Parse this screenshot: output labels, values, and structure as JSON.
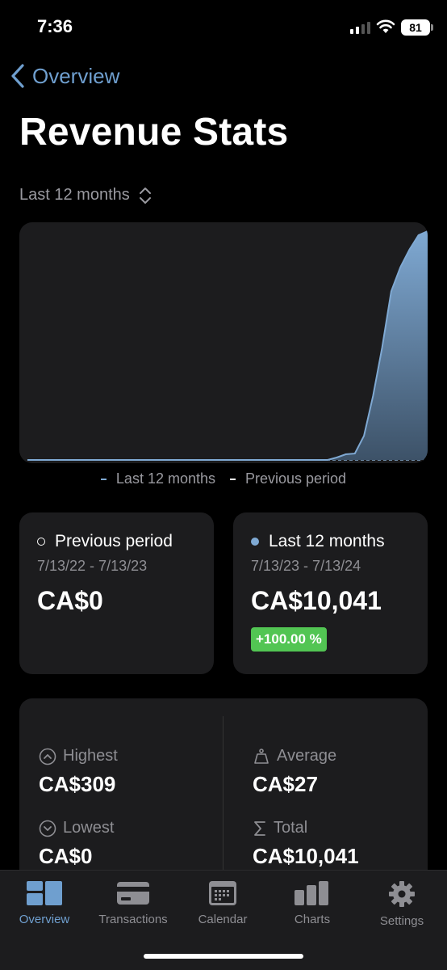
{
  "status_bar": {
    "time": "7:36",
    "battery": "81"
  },
  "nav": {
    "back_label": "Overview",
    "title": "Revenue Stats"
  },
  "range_picker": {
    "label": "Last 12 months"
  },
  "chart_data": {
    "type": "area",
    "series": [
      {
        "name": "Last 12 months",
        "color": "#7fa9d3",
        "values": [
          0,
          0,
          0,
          0,
          0,
          0,
          0,
          0,
          0,
          0,
          0,
          0,
          0,
          0,
          0,
          0,
          0,
          0,
          0,
          0,
          0,
          0,
          0,
          0,
          0,
          0,
          0,
          0,
          0,
          0,
          0,
          0,
          0,
          0,
          3,
          7,
          8,
          30,
          80,
          140,
          210,
          240,
          262,
          280,
          285
        ]
      },
      {
        "name": "Previous period",
        "color": "#ffffff",
        "values": []
      }
    ],
    "ylim": [
      0,
      290
    ],
    "grid": false,
    "legend_placement": "bottom-center"
  },
  "legend": {
    "current": "Last 12 months",
    "previous": "Previous period"
  },
  "periods": {
    "previous": {
      "label": "Previous period",
      "dates": "7/13/22 - 7/13/23",
      "amount": "CA$0"
    },
    "current": {
      "label": "Last 12 months",
      "dates": "7/13/23 - 7/13/24",
      "amount": "CA$10,041",
      "change": "+100.00 %"
    }
  },
  "stats": {
    "highest": {
      "label": "Highest",
      "value": "CA$309",
      "icon": "chevron-up-circle-icon"
    },
    "lowest": {
      "label": "Lowest",
      "value": "CA$0",
      "icon": "chevron-down-circle-icon"
    },
    "average": {
      "label": "Average",
      "value": "CA$27",
      "icon": "scale-icon"
    },
    "total": {
      "label": "Total",
      "value": "CA$10,041",
      "icon": "sigma-icon"
    }
  },
  "tabs": [
    {
      "label": "Overview",
      "icon": "dashboard-icon",
      "active": true
    },
    {
      "label": "Transactions",
      "icon": "credit-card-icon",
      "active": false
    },
    {
      "label": "Calendar",
      "icon": "calendar-icon",
      "active": false
    },
    {
      "label": "Charts",
      "icon": "bar-chart-icon",
      "active": false
    },
    {
      "label": "Settings",
      "icon": "gear-icon",
      "active": false
    }
  ],
  "colors": {
    "accent": "#6f9fcf",
    "positive": "#52c553",
    "card": "#1c1c1e"
  }
}
